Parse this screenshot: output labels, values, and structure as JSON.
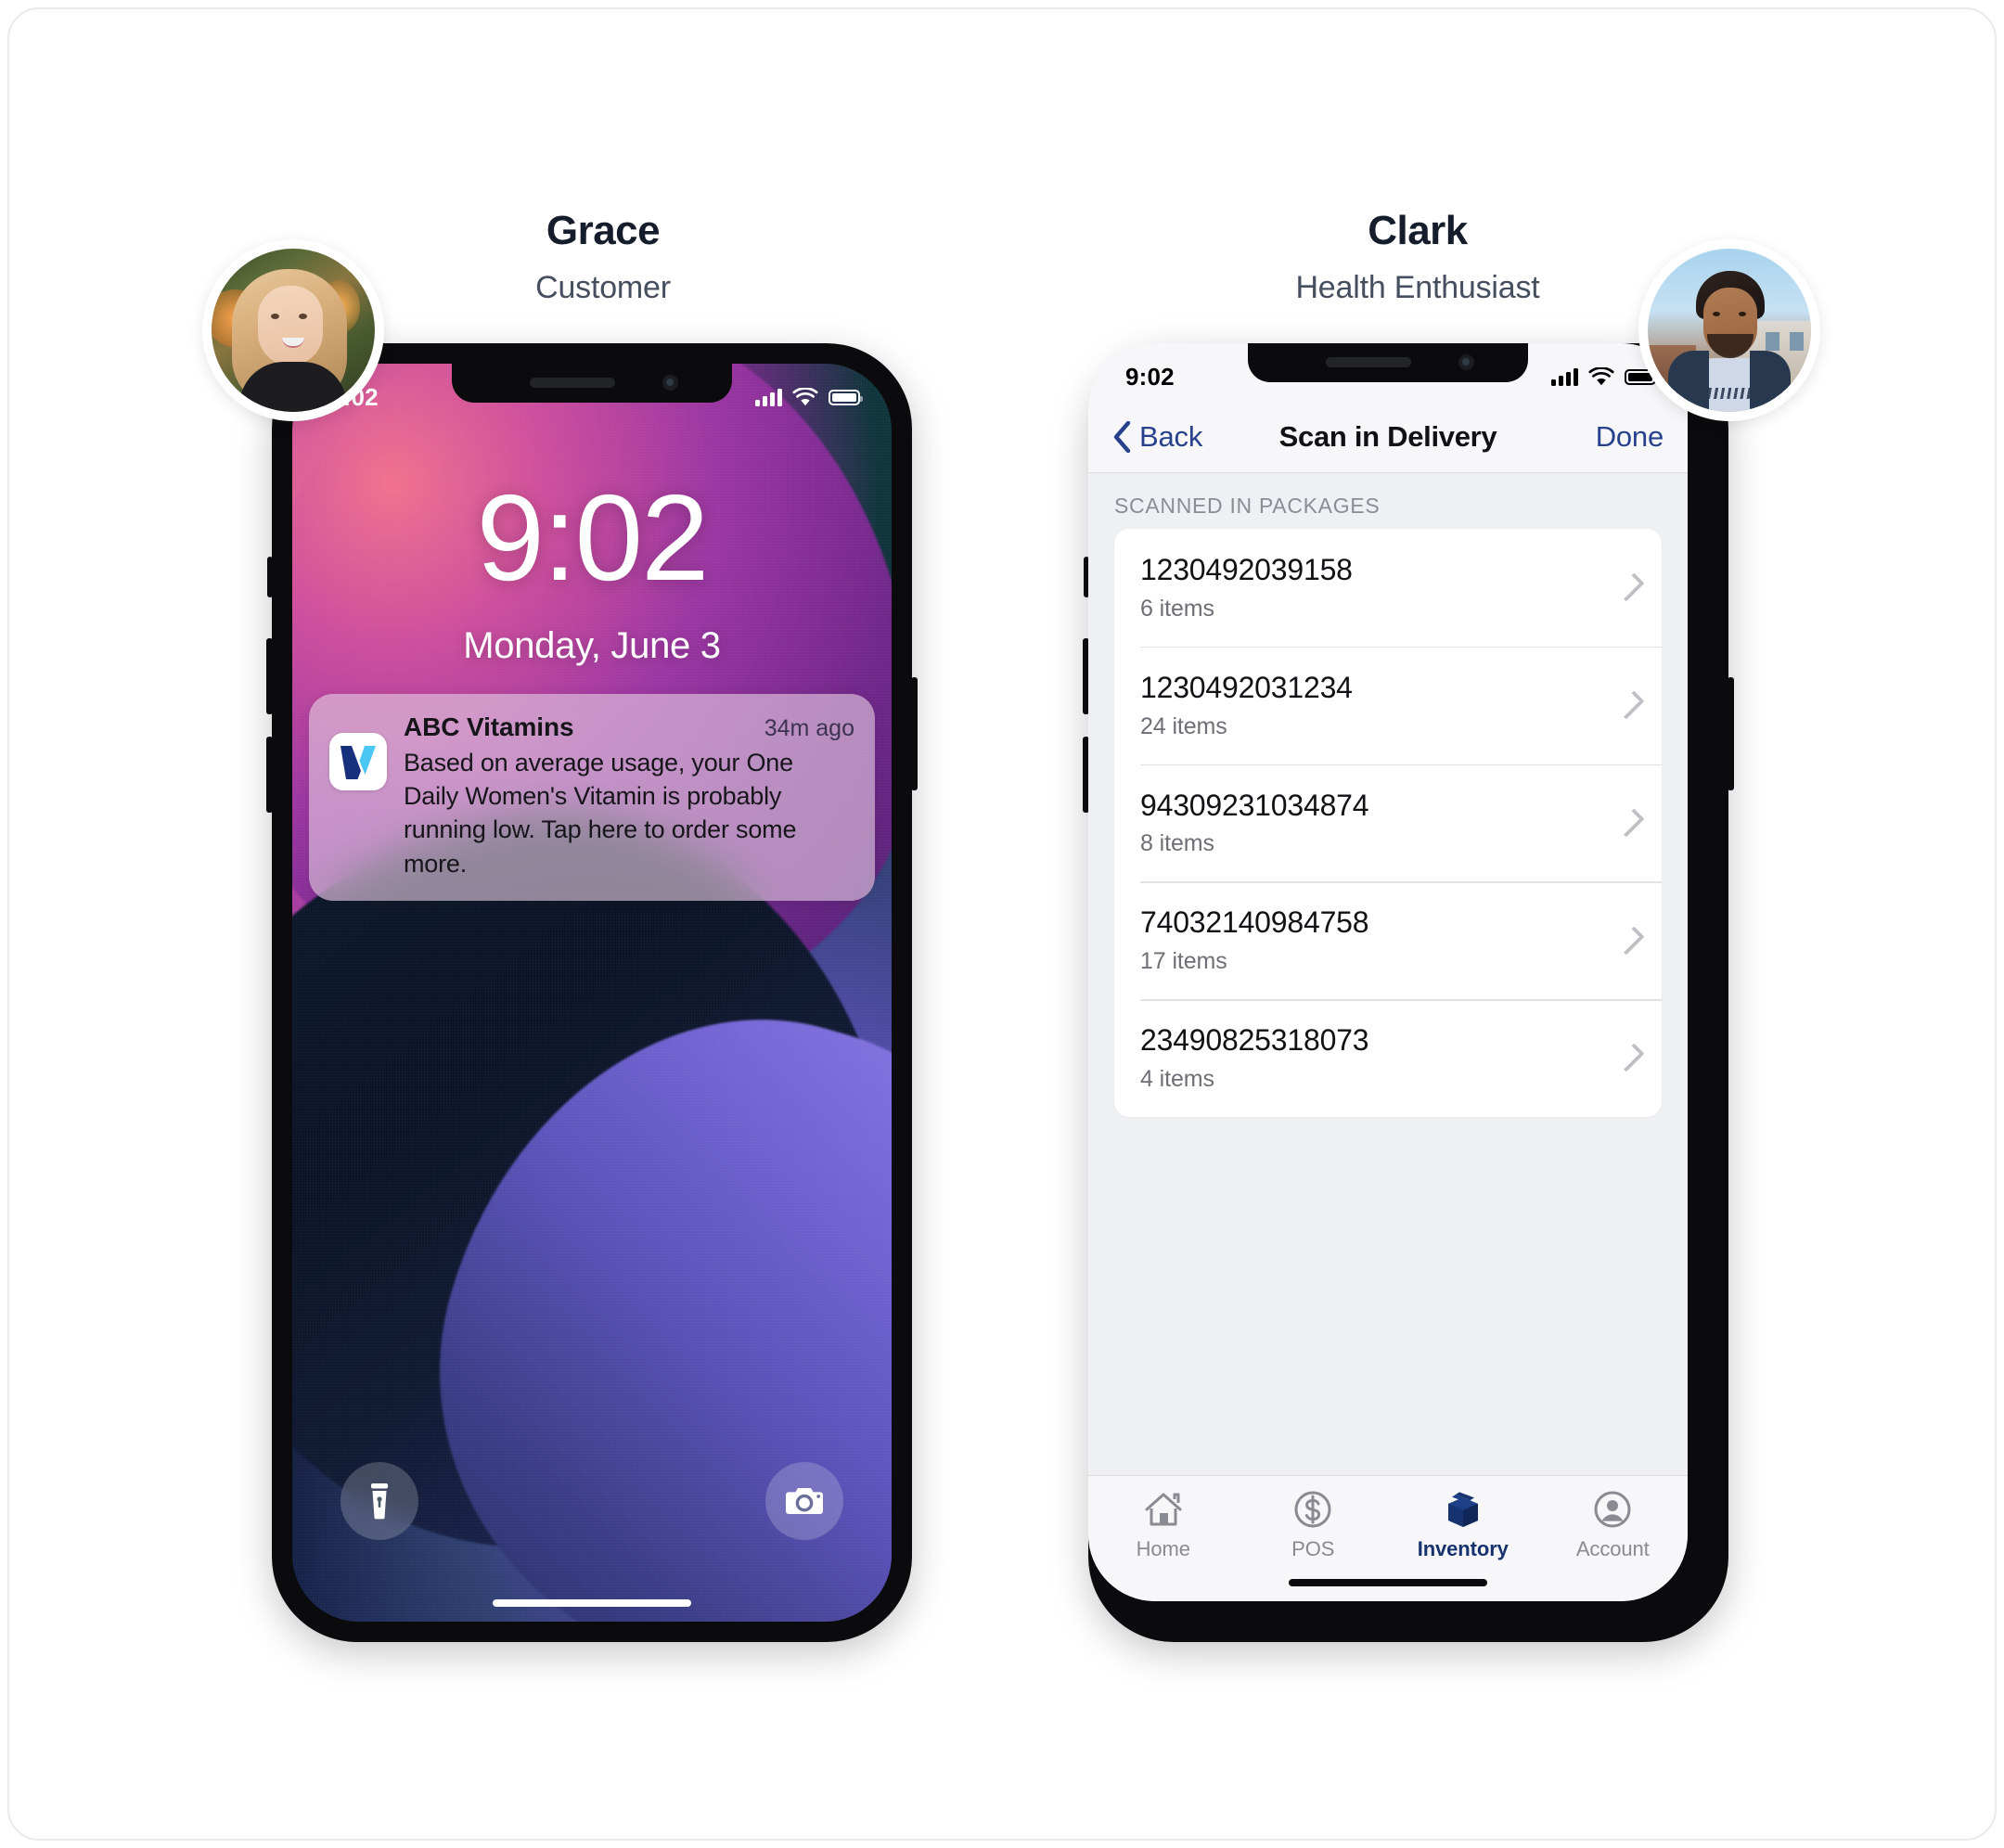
{
  "personas": [
    {
      "name": "Grace",
      "role": "Customer",
      "avatar_icon": "grace-portrait-avatar"
    },
    {
      "name": "Clark",
      "role": "Health Enthusiast",
      "avatar_icon": "clark-portrait-avatar"
    }
  ],
  "lock_screen": {
    "status": {
      "time": "9:02",
      "cellular_icon": "signal-bars-icon",
      "wifi_icon": "wifi-icon",
      "battery_icon": "battery-icon"
    },
    "clock": "9:02",
    "date": "Monday, June 3",
    "notification": {
      "app": "ABC Vitamins",
      "time": "34m ago",
      "message": "Based on average usage, your One Daily Women's Vitamin is probably running low. Tap here to order some more.",
      "app_icon": "abc-vitamins-v-logo-icon"
    },
    "flashlight_icon": "flashlight-icon",
    "camera_icon": "camera-icon"
  },
  "app_screen": {
    "status": {
      "time": "9:02",
      "cellular_icon": "signal-bars-icon",
      "wifi_icon": "wifi-icon",
      "battery_icon": "battery-icon"
    },
    "nav": {
      "back_label": "Back",
      "back_icon": "chevron-left-icon",
      "title": "Scan in Delivery",
      "done_label": "Done"
    },
    "section_label": "SCANNED IN PACKAGES",
    "packages": [
      {
        "id": "1230492039158",
        "count": "6 items"
      },
      {
        "id": "1230492031234",
        "count": "24 items"
      },
      {
        "id": "94309231034874",
        "count": "8 items"
      },
      {
        "id": "74032140984758",
        "count": "17 items"
      },
      {
        "id": "23490825318073",
        "count": "4 items"
      }
    ],
    "tabs": [
      {
        "label": "Home",
        "icon": "home-icon",
        "active": false
      },
      {
        "label": "POS",
        "icon": "dollar-circle-icon",
        "active": false
      },
      {
        "label": "Inventory",
        "icon": "box-package-icon",
        "active": true
      },
      {
        "label": "Account",
        "icon": "person-circle-icon",
        "active": false
      }
    ]
  },
  "colors": {
    "accent_navy": "#27418c",
    "active_tab": "#16326f",
    "text_primary": "#111216",
    "text_secondary": "#6e6e76",
    "screen_bg": "#eff0f4"
  }
}
